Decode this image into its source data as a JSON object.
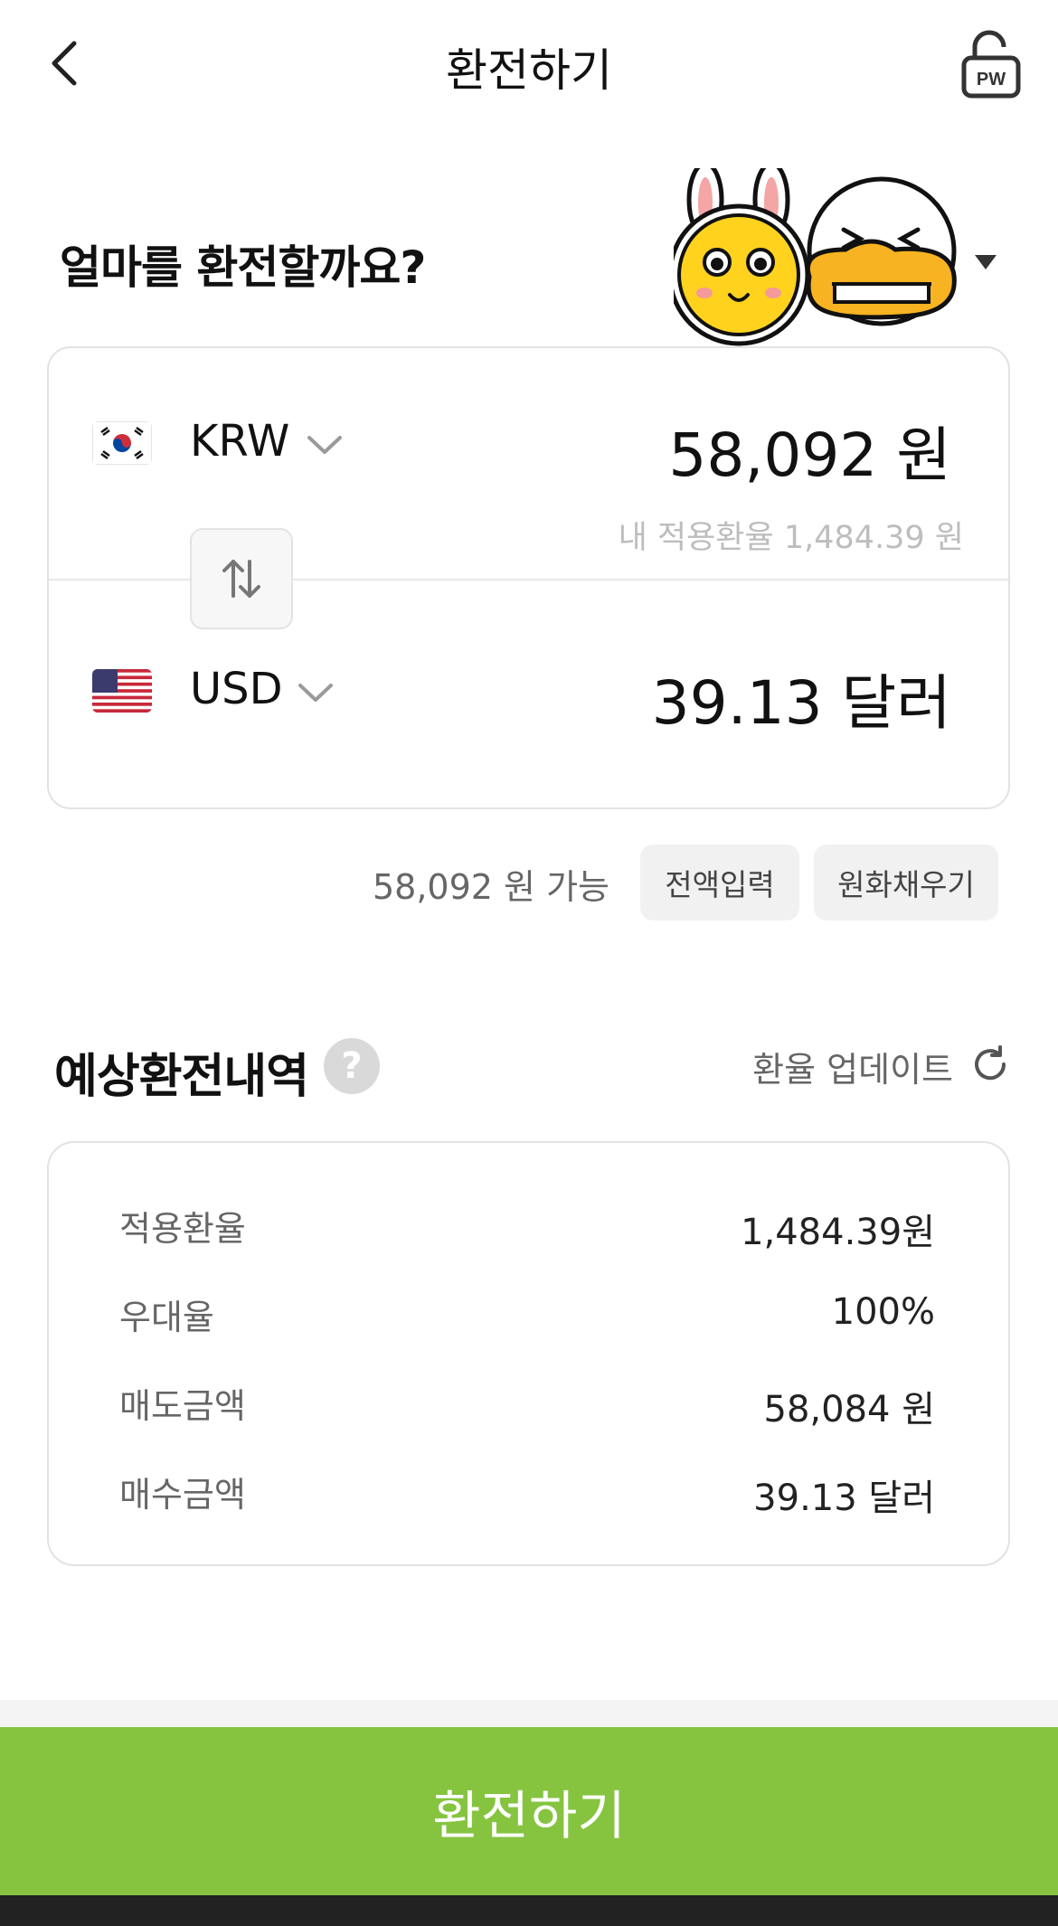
{
  "header": {
    "title": "환전하기",
    "back_icon": "chevron-left-icon",
    "password_icon": "lock-pw-icon",
    "password_badge": "PW"
  },
  "question": "얼마를 환전할까요?",
  "exchange": {
    "from": {
      "currency": "KRW",
      "flag": "south-korea-flag-icon",
      "amount": "58,092 원"
    },
    "to": {
      "currency": "USD",
      "flag": "us-flag-icon",
      "amount": "39.13 달러"
    },
    "rate_hint": "내 적용환율 1,484.39 원",
    "swap_icon": "swap-vertical-icon"
  },
  "available": {
    "text": "58,092 원 가능",
    "full_amount_label": "전액입력",
    "fill_krw_label": "원화채우기"
  },
  "estimate": {
    "title": "예상환전내역",
    "help_symbol": "?",
    "update_label": "환율 업데이트",
    "rows": [
      {
        "label": "적용환율",
        "value": "1,484.39원"
      },
      {
        "label": "우대율",
        "value": "100%"
      },
      {
        "label": "매도금액",
        "value": "58,084 원"
      },
      {
        "label": "매수금액",
        "value": "39.13 달러"
      }
    ]
  },
  "cta_label": "환전하기",
  "colors": {
    "accent": "#86c440",
    "character_yellow": "#ffd21e",
    "duck_orange": "#f7b321"
  }
}
